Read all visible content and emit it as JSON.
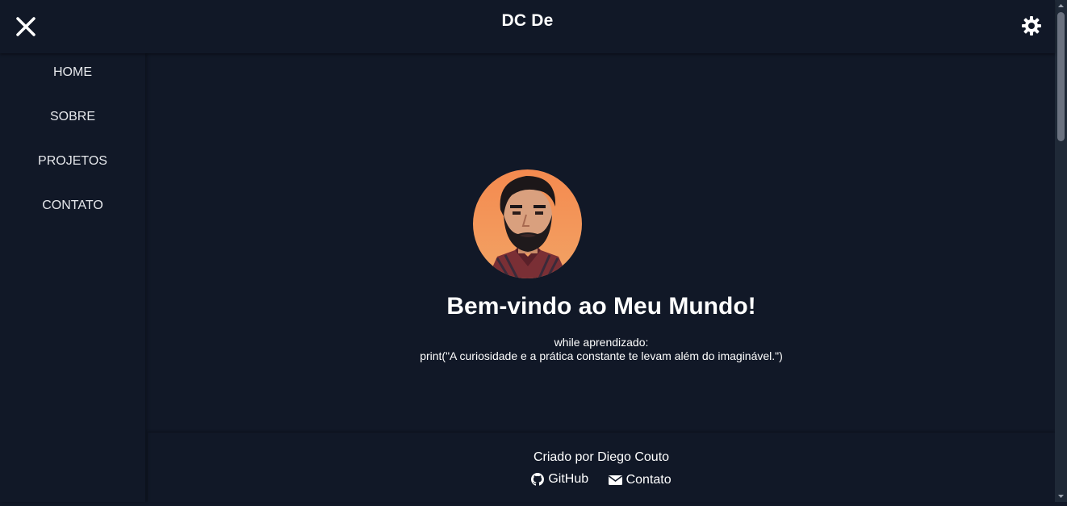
{
  "header": {
    "title": "DC De",
    "close_icon": "close-icon",
    "theme_icon": "sun-gear-icon"
  },
  "sidebar": {
    "items": [
      {
        "label": "HOME"
      },
      {
        "label": "SOBRE"
      },
      {
        "label": "PROJETOS"
      },
      {
        "label": "CONTATO"
      }
    ]
  },
  "hero": {
    "title": "Bem-vindo ao Meu Mundo!",
    "code_line_1": "while aprendizado:",
    "code_line_2": "print(\"A curiosidade e a prática constante te levam além do imaginável.\")",
    "avatar_icon": "profile-avatar"
  },
  "footer": {
    "credit": "Criado por Diego Couto",
    "links": [
      {
        "label": "GitHub",
        "icon": "github-icon"
      },
      {
        "label": "Contato",
        "icon": "envelope-icon"
      }
    ]
  },
  "colors": {
    "background": "#111827",
    "text": "#ffffff",
    "avatar_bg": "#f0955a"
  }
}
